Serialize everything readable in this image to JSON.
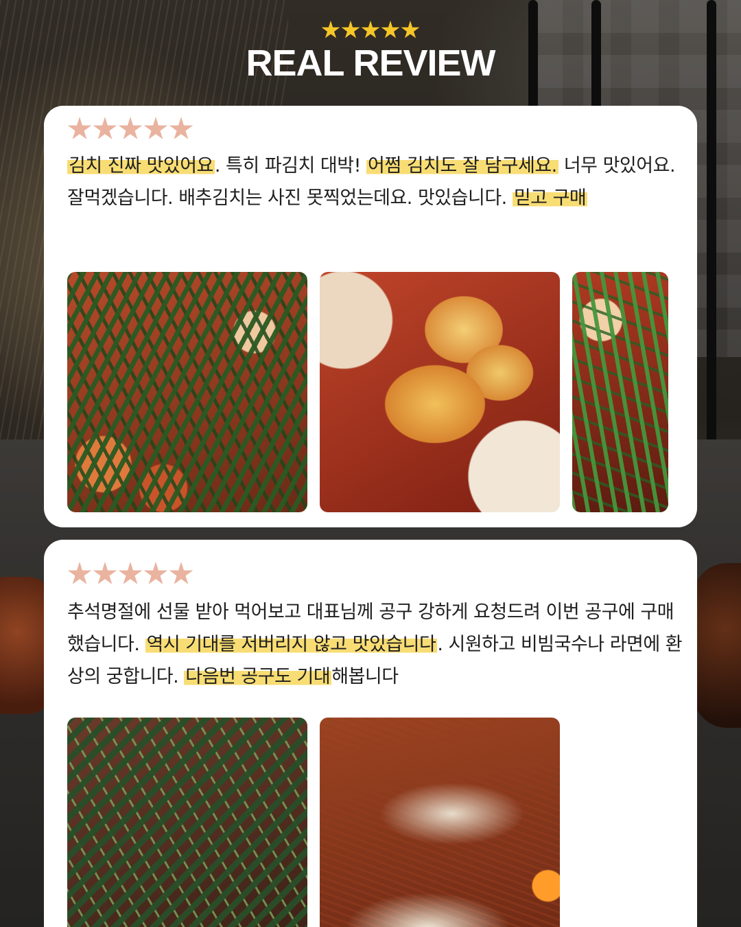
{
  "header": {
    "star_count": 5,
    "title": "REAL REVIEW",
    "star_color": "#f5c628"
  },
  "reviews": [
    {
      "rating": 5,
      "star_color": "#e9b3a0",
      "text_segments": [
        {
          "text": "김치 진짜 맛있어요",
          "highlight": true
        },
        {
          "text": ". 특히 파김치 대박! ",
          "highlight": false
        },
        {
          "text": "어쩜 김치도 잘 담구세요.",
          "highlight": true
        },
        {
          "text": " 너무 맛있어요. 잘먹겠습니다. 배추김치는 사진 못찍었는데요. 맛있습니다. ",
          "highlight": false
        },
        {
          "text": "믿고 구매",
          "highlight": true
        }
      ],
      "photos": [
        "green-onion-kimchi-photo",
        "radish-kimchi-photo",
        "greens-kimchi-photo-partial"
      ]
    },
    {
      "rating": 5,
      "star_color": "#e9b3a0",
      "text_segments": [
        {
          "text": "추석명절에 선물 받아 먹어보고 대표님께 공구 강하게 요청드려 이번 공구에 구매했습니다. ",
          "highlight": false
        },
        {
          "text": "역시 기대를 저버리지 않고 맛있습니다",
          "highlight": true
        },
        {
          "text": ". 시원하고 비빔국수나 라면에 환상의 궁합니다. ",
          "highlight": false
        },
        {
          "text": "다음번 공구도 기대",
          "highlight": true
        },
        {
          "text": "해봅니다",
          "highlight": false
        }
      ],
      "photos": [
        "young-radish-kimchi-photo",
        "cabbage-kimchi-photo"
      ]
    }
  ],
  "colors": {
    "highlight": "#f8dd74",
    "card_background": "#ffffff",
    "title_color": "#ffffff"
  }
}
